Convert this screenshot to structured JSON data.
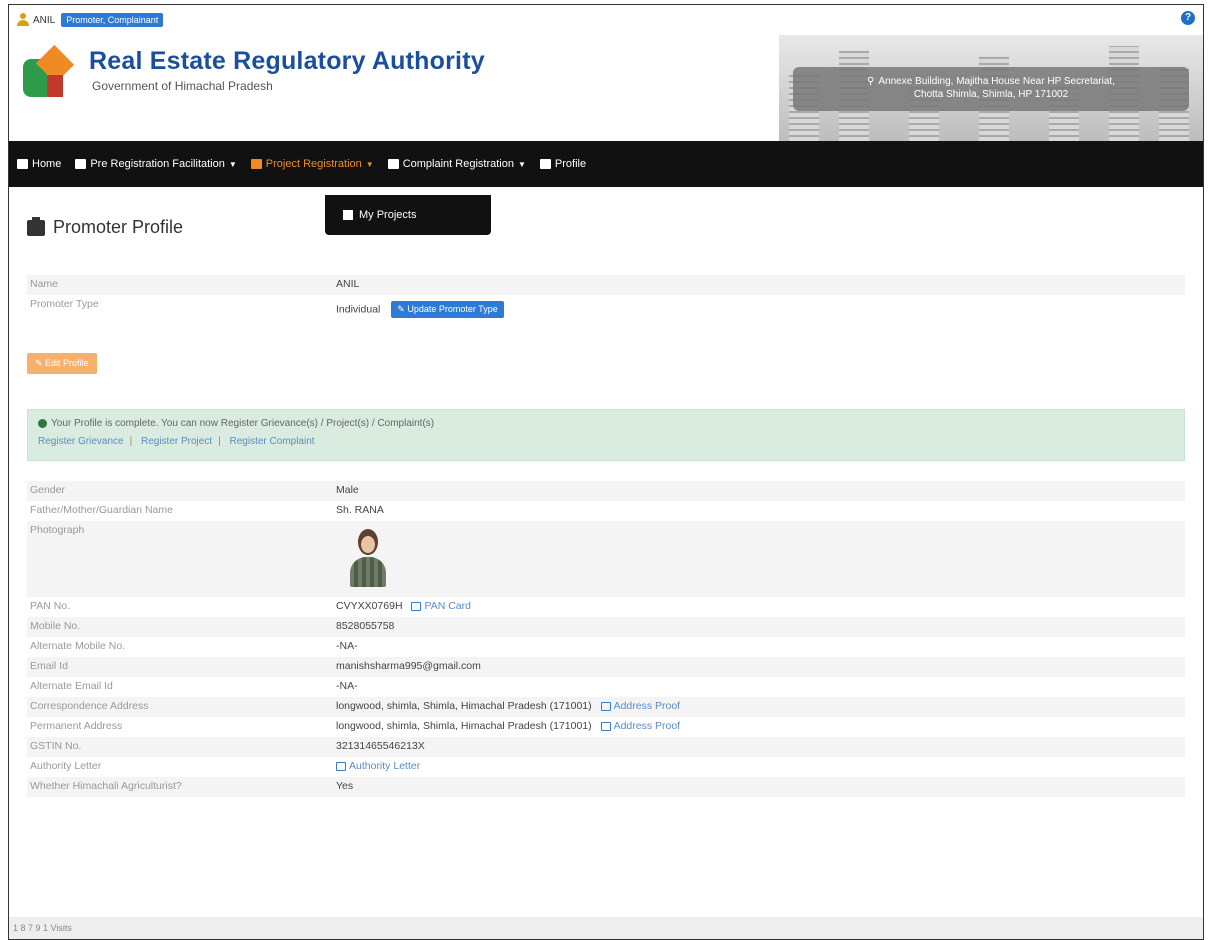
{
  "topbar": {
    "user_name": "ANIL",
    "role_badge": "Promoter, Complainant"
  },
  "header": {
    "title": "Real Estate Regulatory Authority",
    "subtitle": "Government of Himachal Pradesh",
    "address_line1": "Annexe Building, Majitha House Near HP Secretariat,",
    "address_line2": "Chotta Shimla, Shimla, HP 171002"
  },
  "nav": {
    "items": [
      {
        "label": "Home",
        "icon": "bank-icon",
        "dropdown": false
      },
      {
        "label": "Pre Registration Facilitation",
        "icon": "users-icon",
        "dropdown": true
      },
      {
        "label": "Project Registration",
        "icon": "building-icon",
        "dropdown": true,
        "active": true
      },
      {
        "label": "Complaint Registration",
        "icon": "files-icon",
        "dropdown": true
      },
      {
        "label": "Profile",
        "icon": "id-card-icon",
        "dropdown": false
      }
    ],
    "dropdown_items": [
      "My Projects"
    ]
  },
  "profile": {
    "title": "Promoter Profile",
    "top_fields": [
      {
        "label": "Name",
        "value": "ANIL"
      },
      {
        "label": "Promoter Type",
        "value": "Individual"
      }
    ],
    "update_type_button": "Update Promoter Type",
    "edit_button": "Edit Profile",
    "alert": {
      "message": "Your Profile is complete. You can now Register Grievance(s) / Project(s) / Complaint(s)",
      "links": [
        "Register Grievance",
        "Register Project",
        "Register Complaint"
      ]
    },
    "details": {
      "gender": {
        "label": "Gender",
        "value": "Male"
      },
      "father": {
        "label": "Father/Mother/Guardian Name",
        "value": "Sh. RANA"
      },
      "photo": {
        "label": "Photograph"
      },
      "pan": {
        "label": "PAN No.",
        "value": "CVYXX0769H",
        "link": "PAN Card"
      },
      "mobile": {
        "label": "Mobile No.",
        "value": "8528055758"
      },
      "alt_mobile": {
        "label": "Alternate Mobile No.",
        "value": "-NA-"
      },
      "email": {
        "label": "Email Id",
        "value": "manishsharma995@gmail.com"
      },
      "alt_email": {
        "label": "Alternate Email Id",
        "value": "-NA-"
      },
      "corr_address": {
        "label": "Correspondence Address",
        "value": "longwood, shimla, Shimla, Himachal Pradesh (171001)",
        "link": "Address Proof"
      },
      "perm_address": {
        "label": "Permanent Address",
        "value": "longwood, shimla, Shimla, Himachal Pradesh (171001)",
        "link": "Address Proof"
      },
      "gstin": {
        "label": "GSTIN No.",
        "value": "32131465546213X"
      },
      "authority": {
        "label": "Authority Letter",
        "link": "Authority Letter"
      },
      "agriculturist": {
        "label": "Whether Himachali Agriculturist?",
        "value": "Yes"
      }
    }
  },
  "footer": {
    "text": "1 8 7 9 1  Visits"
  }
}
